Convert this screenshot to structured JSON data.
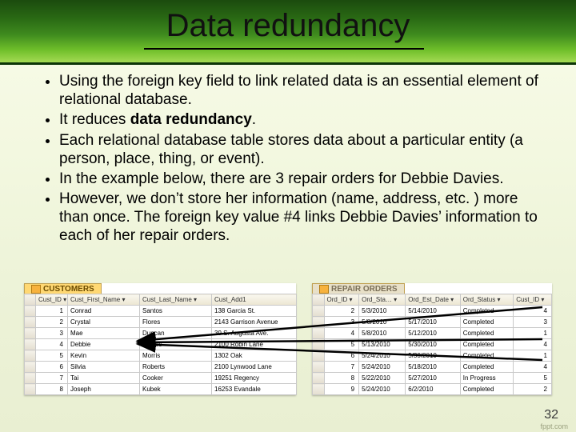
{
  "title": "Data redundancy",
  "bullets": [
    "Using the foreign key field to link related data is an essential element of relational database.",
    "It reduces <b>data redundancy</b>.",
    "Each relational database table stores data about a particular entity (a person, place, thing, or event).",
    "In the example below, there are 3 repair orders for Debbie Davies.",
    "However, we don’t store her information (name, address, etc. ) more than once. The foreign key value #4 links Debbie Davies’ information to each of her repair orders."
  ],
  "customers": {
    "tab": "CUSTOMERS",
    "headers": [
      "Cust_ID  ▾",
      "Cust_First_Name  ▾",
      "Cust_Last_Name  ▾",
      "Cust_Add1"
    ],
    "rows": [
      [
        "1",
        "Conrad",
        "Santos",
        "138 Garcia St."
      ],
      [
        "2",
        "Crystal",
        "Flores",
        "2143 Garrison Avenue"
      ],
      [
        "3",
        "Mae",
        "Duncan",
        "39 S. Augusta Ave."
      ],
      [
        "4",
        "Debbie",
        "Davies",
        "2100 Robin Lane"
      ],
      [
        "5",
        "Kevin",
        "Morris",
        "1302 Oak"
      ],
      [
        "6",
        "Silvia",
        "Roberts",
        "2100 Lynwood Lane"
      ],
      [
        "7",
        "Tai",
        "Cooker",
        "19251 Regency"
      ],
      [
        "8",
        "Joseph",
        "Kubek",
        "16253 Evandale"
      ]
    ]
  },
  "repairs": {
    "tab": "REPAIR ORDERS",
    "headers": [
      "Ord_ID ▾",
      "Ord_Sta… ▾",
      "Ord_Est_Date ▾",
      "Ord_Status ▾",
      "Cust_ID ▾"
    ],
    "rows": [
      [
        "2",
        "5/3/2010",
        "5/14/2010",
        "Completed",
        "4"
      ],
      [
        "3",
        "5/8/2010",
        "5/17/2010",
        "Completed",
        "3"
      ],
      [
        "4",
        "5/8/2010",
        "5/12/2010",
        "Completed",
        "1"
      ],
      [
        "5",
        "5/13/2010",
        "5/30/2010",
        "Completed",
        "4"
      ],
      [
        "6",
        "5/24/2010",
        "5/30/2010",
        "Completed",
        "1"
      ],
      [
        "7",
        "5/24/2010",
        "5/18/2010",
        "Completed",
        "4"
      ],
      [
        "8",
        "5/22/2010",
        "5/27/2010",
        "In Progress",
        "5"
      ],
      [
        "9",
        "5/24/2010",
        "6/2/2010",
        "Completed",
        "2"
      ]
    ]
  },
  "slide_number": "32",
  "footer": "fppt.com"
}
